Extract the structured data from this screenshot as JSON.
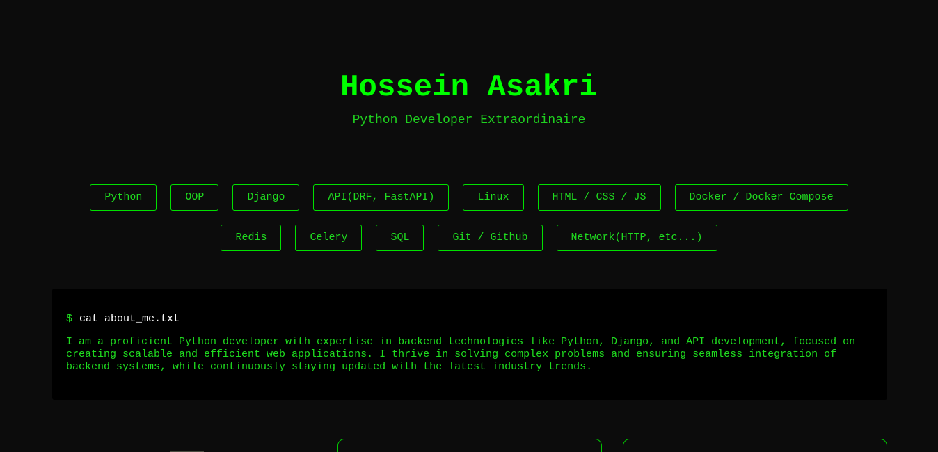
{
  "header": {
    "name": "Hossein Asakri",
    "tagline": "Python Developer Extraordinaire"
  },
  "skills": [
    "Python",
    "OOP",
    "Django",
    "API(DRF, FastAPI)",
    "Linux",
    "HTML / CSS / JS",
    "Docker / Docker Compose",
    "Redis",
    "Celery",
    "SQL",
    "Git / Github",
    "Network(HTTP, etc...)"
  ],
  "terminal": {
    "prompt": "$",
    "command": "cat about_me.txt",
    "output": "I am a proficient Python developer with expertise in backend technologies like Python, Django, and API development, focused on creating scalable and efficient web applications. I thrive in solving complex problems and ensuring seamless integration of backend systems, while continuously staying updated with the latest industry trends."
  },
  "colors": {
    "background": "#0c0c0c",
    "accent": "#00ff00",
    "terminal_bg": "#000000"
  }
}
